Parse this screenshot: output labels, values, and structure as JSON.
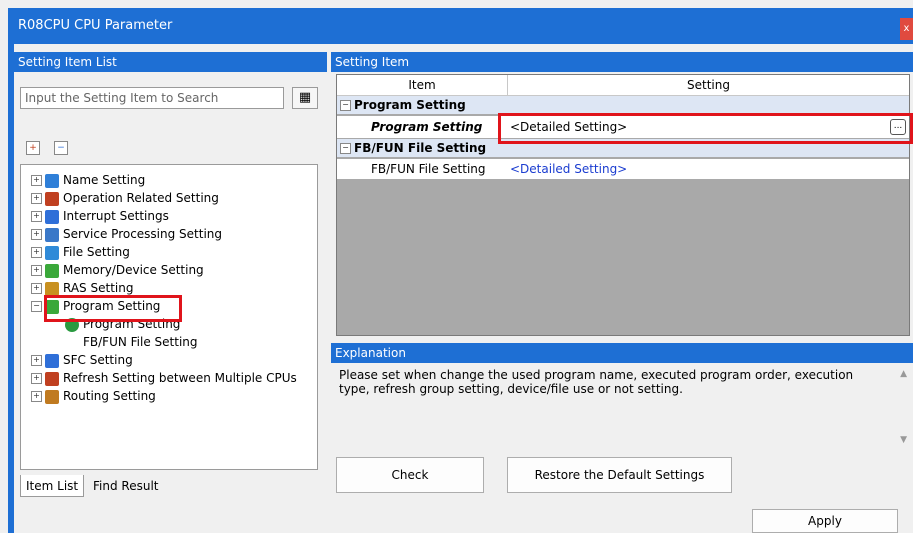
{
  "window": {
    "title": "R08CPU CPU Parameter",
    "close_glyph": "x"
  },
  "left_panel": {
    "header": "Setting Item List",
    "search_placeholder": "Input the Setting Item to Search",
    "tree": [
      {
        "label": "Name Setting",
        "icon": "name-icon",
        "color": "#2f7fd8"
      },
      {
        "label": "Operation Related Setting",
        "icon": "operation-icon",
        "color": "#c04020"
      },
      {
        "label": "Interrupt Settings",
        "icon": "interrupt-icon",
        "color": "#2f6fd8"
      },
      {
        "label": "Service Processing Setting",
        "icon": "service-icon",
        "color": "#3a78c8"
      },
      {
        "label": "File Setting",
        "icon": "file-icon",
        "color": "#2f8ad8"
      },
      {
        "label": "Memory/Device Setting",
        "icon": "memory-icon",
        "color": "#3aa83a"
      },
      {
        "label": "RAS Setting",
        "icon": "ras-icon",
        "color": "#c89020"
      },
      {
        "label": "Program Setting",
        "icon": "program-icon",
        "color": "#3aa83a"
      },
      {
        "label": "Program Setting",
        "icon": "check-icon",
        "color": "#2a9a40"
      },
      {
        "label": "FB/FUN File Setting",
        "icon": "",
        "color": ""
      },
      {
        "label": "SFC Setting",
        "icon": "sfc-icon",
        "color": "#2f6fd8"
      },
      {
        "label": "Refresh Setting between Multiple CPUs",
        "icon": "refresh-icon",
        "color": "#c04020"
      },
      {
        "label": "Routing Setting",
        "icon": "routing-icon",
        "color": "#c07a20"
      }
    ],
    "tabs": [
      "Item List",
      "Find Result"
    ]
  },
  "right_panel": {
    "header": "Setting Item",
    "columns": [
      "Item",
      "Setting"
    ],
    "groups": [
      {
        "title": "Program Setting",
        "item": "Program Setting",
        "value": "<Detailed Setting>"
      },
      {
        "title": "FB/FUN File Setting",
        "item": "FB/FUN File Setting",
        "value": "<Detailed Setting>"
      }
    ],
    "ellipsis": "...",
    "explanation_header": "Explanation",
    "explanation_text": "Please set when change the used program name, executed program order, execution type, refresh group setting, device/file use or not setting.",
    "check_button": "Check",
    "restore_button": "Restore the Default Settings",
    "apply_button": "Apply"
  },
  "highlight_color": "#e0141b"
}
